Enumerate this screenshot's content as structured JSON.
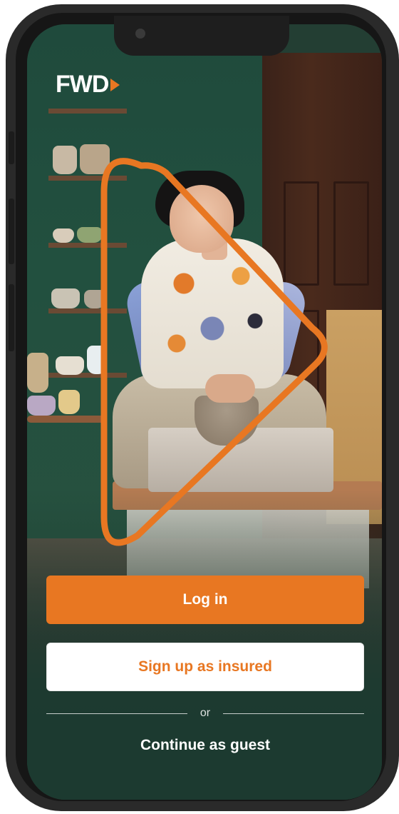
{
  "brand": {
    "logo_text": "FWD",
    "accent_color": "#e87722"
  },
  "auth": {
    "login_label": "Log in",
    "signup_label": "Sign up as insured",
    "divider_text": "or",
    "guest_label": "Continue as guest"
  },
  "icons": {
    "logo_mark": "play-triangle-icon",
    "brand_outline": "rounded-triangle-outline-icon"
  }
}
